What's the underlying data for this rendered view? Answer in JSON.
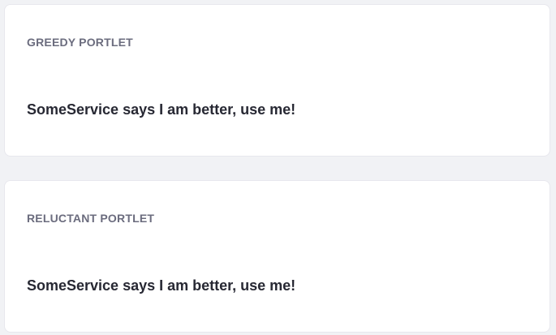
{
  "portlets": [
    {
      "title": "GREEDY PORTLET",
      "message": "SomeService says I am better, use me!"
    },
    {
      "title": "RELUCTANT PORTLET",
      "message": "SomeService says I am better, use me!"
    }
  ]
}
